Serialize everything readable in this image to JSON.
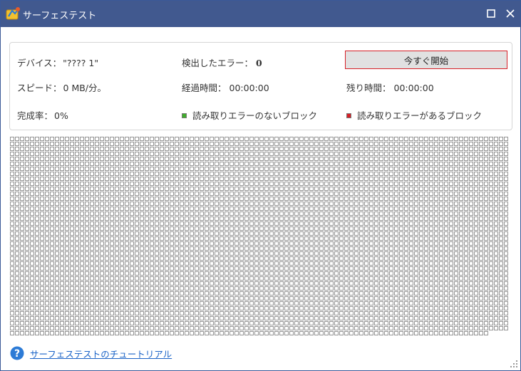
{
  "window": {
    "title": "サーフェステスト"
  },
  "info": {
    "device_label": "デバイス：",
    "device_value": "\"???? 1\"",
    "errors_label": "検出したエラー：",
    "errors_value": "0",
    "start_button": "今すぐ開始",
    "speed_label": "スピード：",
    "speed_value": "0 MB/分。",
    "elapsed_label": "経過時間：",
    "elapsed_value": "00:00:00",
    "remaining_label": "残り時間：",
    "remaining_value": "00:00:00",
    "completion_label": "完成率：",
    "completion_value": "0%",
    "legend_ok": "読み取りエラーのないブロック",
    "legend_err": "読み取りエラーがあるブロック"
  },
  "colors": {
    "titlebar": "#41598f",
    "ok_block": "#3fae2a",
    "error_block": "#d61f26",
    "block_outline": "#7a7a7a",
    "link": "#1a63c7"
  },
  "blocks": {
    "columns": 100,
    "rows": 40,
    "last_row_count": 96
  },
  "footer": {
    "tutorial_link": "サーフェステストのチュートリアル"
  }
}
